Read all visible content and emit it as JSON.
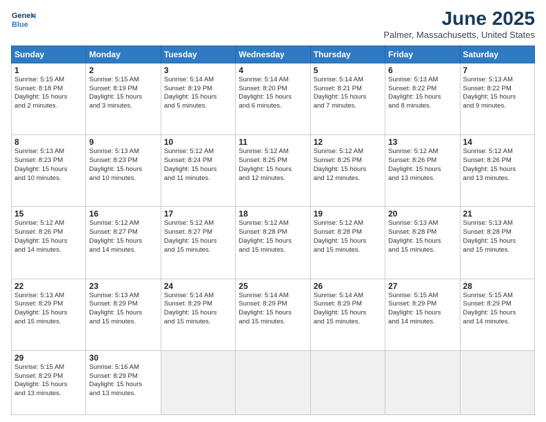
{
  "header": {
    "logo_line1": "General",
    "logo_line2": "Blue",
    "month": "June 2025",
    "location": "Palmer, Massachusetts, United States"
  },
  "days_of_week": [
    "Sunday",
    "Monday",
    "Tuesday",
    "Wednesday",
    "Thursday",
    "Friday",
    "Saturday"
  ],
  "weeks": [
    [
      {
        "day": "1",
        "sunrise": "5:15 AM",
        "sunset": "8:18 PM",
        "daylight": "15 hours and 2 minutes."
      },
      {
        "day": "2",
        "sunrise": "5:15 AM",
        "sunset": "8:19 PM",
        "daylight": "15 hours and 3 minutes."
      },
      {
        "day": "3",
        "sunrise": "5:14 AM",
        "sunset": "8:19 PM",
        "daylight": "15 hours and 5 minutes."
      },
      {
        "day": "4",
        "sunrise": "5:14 AM",
        "sunset": "8:20 PM",
        "daylight": "15 hours and 6 minutes."
      },
      {
        "day": "5",
        "sunrise": "5:14 AM",
        "sunset": "8:21 PM",
        "daylight": "15 hours and 7 minutes."
      },
      {
        "day": "6",
        "sunrise": "5:13 AM",
        "sunset": "8:22 PM",
        "daylight": "15 hours and 8 minutes."
      },
      {
        "day": "7",
        "sunrise": "5:13 AM",
        "sunset": "8:22 PM",
        "daylight": "15 hours and 9 minutes."
      }
    ],
    [
      {
        "day": "8",
        "sunrise": "5:13 AM",
        "sunset": "8:23 PM",
        "daylight": "15 hours and 10 minutes."
      },
      {
        "day": "9",
        "sunrise": "5:13 AM",
        "sunset": "8:23 PM",
        "daylight": "15 hours and 10 minutes."
      },
      {
        "day": "10",
        "sunrise": "5:12 AM",
        "sunset": "8:24 PM",
        "daylight": "15 hours and 11 minutes."
      },
      {
        "day": "11",
        "sunrise": "5:12 AM",
        "sunset": "8:25 PM",
        "daylight": "15 hours and 12 minutes."
      },
      {
        "day": "12",
        "sunrise": "5:12 AM",
        "sunset": "8:25 PM",
        "daylight": "15 hours and 12 minutes."
      },
      {
        "day": "13",
        "sunrise": "5:12 AM",
        "sunset": "8:26 PM",
        "daylight": "15 hours and 13 minutes."
      },
      {
        "day": "14",
        "sunrise": "5:12 AM",
        "sunset": "8:26 PM",
        "daylight": "15 hours and 13 minutes."
      }
    ],
    [
      {
        "day": "15",
        "sunrise": "5:12 AM",
        "sunset": "8:26 PM",
        "daylight": "15 hours and 14 minutes."
      },
      {
        "day": "16",
        "sunrise": "5:12 AM",
        "sunset": "8:27 PM",
        "daylight": "15 hours and 14 minutes."
      },
      {
        "day": "17",
        "sunrise": "5:12 AM",
        "sunset": "8:27 PM",
        "daylight": "15 hours and 15 minutes."
      },
      {
        "day": "18",
        "sunrise": "5:12 AM",
        "sunset": "8:28 PM",
        "daylight": "15 hours and 15 minutes."
      },
      {
        "day": "19",
        "sunrise": "5:12 AM",
        "sunset": "8:28 PM",
        "daylight": "15 hours and 15 minutes."
      },
      {
        "day": "20",
        "sunrise": "5:13 AM",
        "sunset": "8:28 PM",
        "daylight": "15 hours and 15 minutes."
      },
      {
        "day": "21",
        "sunrise": "5:13 AM",
        "sunset": "8:28 PM",
        "daylight": "15 hours and 15 minutes."
      }
    ],
    [
      {
        "day": "22",
        "sunrise": "5:13 AM",
        "sunset": "8:29 PM",
        "daylight": "15 hours and 15 minutes."
      },
      {
        "day": "23",
        "sunrise": "5:13 AM",
        "sunset": "8:29 PM",
        "daylight": "15 hours and 15 minutes."
      },
      {
        "day": "24",
        "sunrise": "5:14 AM",
        "sunset": "8:29 PM",
        "daylight": "15 hours and 15 minutes."
      },
      {
        "day": "25",
        "sunrise": "5:14 AM",
        "sunset": "8:29 PM",
        "daylight": "15 hours and 15 minutes."
      },
      {
        "day": "26",
        "sunrise": "5:14 AM",
        "sunset": "8:29 PM",
        "daylight": "15 hours and 15 minutes."
      },
      {
        "day": "27",
        "sunrise": "5:15 AM",
        "sunset": "8:29 PM",
        "daylight": "15 hours and 14 minutes."
      },
      {
        "day": "28",
        "sunrise": "5:15 AM",
        "sunset": "8:29 PM",
        "daylight": "15 hours and 14 minutes."
      }
    ],
    [
      {
        "day": "29",
        "sunrise": "5:15 AM",
        "sunset": "8:29 PM",
        "daylight": "15 hours and 13 minutes."
      },
      {
        "day": "30",
        "sunrise": "5:16 AM",
        "sunset": "8:29 PM",
        "daylight": "15 hours and 13 minutes."
      },
      null,
      null,
      null,
      null,
      null
    ]
  ],
  "labels": {
    "sunrise": "Sunrise: ",
    "sunset": "Sunset: ",
    "daylight": "Daylight: "
  }
}
